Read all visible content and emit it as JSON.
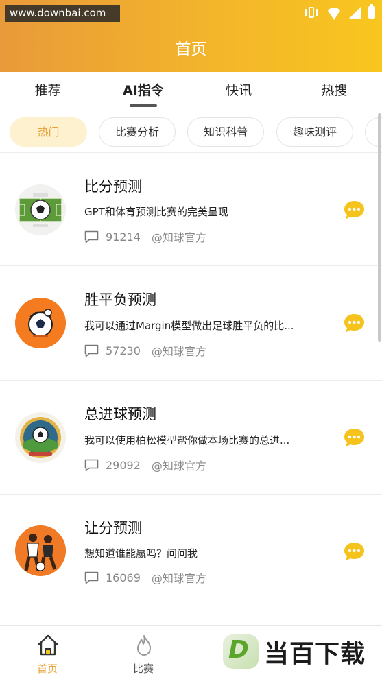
{
  "watermark_top": "www.downbai.com",
  "page_title": "首页",
  "tabs": [
    {
      "label": "推荐"
    },
    {
      "label": "AI指令"
    },
    {
      "label": "快讯"
    },
    {
      "label": "热搜"
    }
  ],
  "active_tab": "AI指令",
  "chips": [
    {
      "label": "热门"
    },
    {
      "label": "比赛分析"
    },
    {
      "label": "知识科普"
    },
    {
      "label": "趣味测评"
    }
  ],
  "items": [
    {
      "title": "比分预测",
      "desc": "GPT和体育预测比赛的完美呈现",
      "count": "91214",
      "author": "@知球官方",
      "avatar_icon": "soccer-field-icon"
    },
    {
      "title": "胜平负预测",
      "desc": "我可以通过Margin模型做出足球胜平负的比...",
      "count": "57230",
      "author": "@知球官方",
      "avatar_icon": "soccer-ball-icon"
    },
    {
      "title": "总进球预测",
      "desc": "我可以使用柏松模型帮你做本场比赛的总进...",
      "count": "29092",
      "author": "@知球官方",
      "avatar_icon": "stadium-badge-icon"
    },
    {
      "title": "让分预测",
      "desc": "想知道谁能赢吗？问问我",
      "count": "16069",
      "author": "@知球官方",
      "avatar_icon": "players-icon"
    }
  ],
  "bottom_nav": [
    {
      "label": "首页",
      "icon": "home-icon",
      "active": true
    },
    {
      "label": "比赛",
      "icon": "flame-icon",
      "active": false
    }
  ],
  "brand_watermark": {
    "logo_letter": "D",
    "text": "当百下载"
  },
  "colors": {
    "accent": "#e9a43b",
    "header_start": "#e99a3a",
    "header_end": "#f8c61f",
    "chat_bubble": "#f6c21c"
  }
}
